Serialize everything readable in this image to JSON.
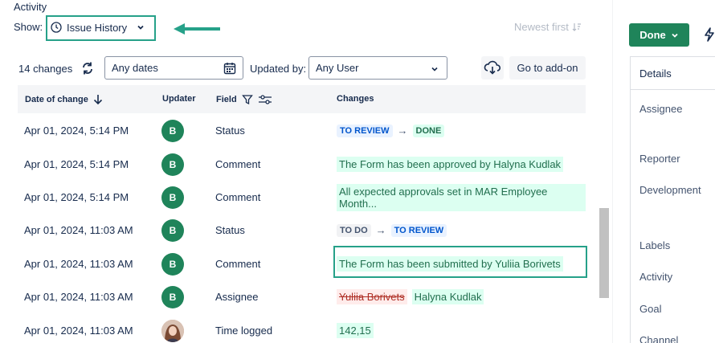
{
  "activity": {
    "title": "Activity",
    "show_label": "Show:",
    "view_select": "Issue History",
    "sort_label": "Newest first"
  },
  "filters": {
    "changes_count": "14 changes",
    "date_value": "Any dates",
    "updated_by_label": "Updated by:",
    "user_value": "Any User",
    "addon_button": "Go to add-on"
  },
  "table": {
    "headers": {
      "date": "Date of change",
      "updater": "Updater",
      "field": "Field",
      "changes": "Changes"
    },
    "rows": [
      {
        "date": "Apr 01, 2024, 5:14 PM",
        "updater": "B",
        "field": "Status",
        "from": "TO REVIEW",
        "to": "DONE"
      },
      {
        "date": "Apr 01, 2024, 5:14 PM",
        "updater": "B",
        "field": "Comment",
        "text": "The Form has been approved by Halyna Kudlak"
      },
      {
        "date": "Apr 01, 2024, 5:14 PM",
        "updater": "B",
        "field": "Comment",
        "text": "All expected approvals set in MAR Employee Month..."
      },
      {
        "date": "Apr 01, 2024, 11:03 AM",
        "updater": "B",
        "field": "Status",
        "from": "TO DO",
        "to": "TO REVIEW"
      },
      {
        "date": "Apr 01, 2024, 11:03 AM",
        "updater": "B",
        "field": "Comment",
        "text": "The Form has been submitted by Yuliia Borivets"
      },
      {
        "date": "Apr 01, 2024, 11:03 AM",
        "updater": "B",
        "field": "Assignee",
        "removed": "Yuliia Borivets",
        "added": "Halyna Kudlak"
      },
      {
        "date": "Apr 01, 2024, 11:03 AM",
        "updater": "",
        "field": "Time logged",
        "text": "142,15"
      }
    ]
  },
  "sidebar": {
    "done_button": "Done",
    "details_title": "Details",
    "fields": [
      "Assignee",
      "Reporter",
      "Development",
      "Labels",
      "Activity",
      "Goal",
      "Channel"
    ]
  },
  "colors": {
    "accent": "#26a189",
    "done_green": "#1f845a",
    "avatar_green": "#1f845a"
  }
}
